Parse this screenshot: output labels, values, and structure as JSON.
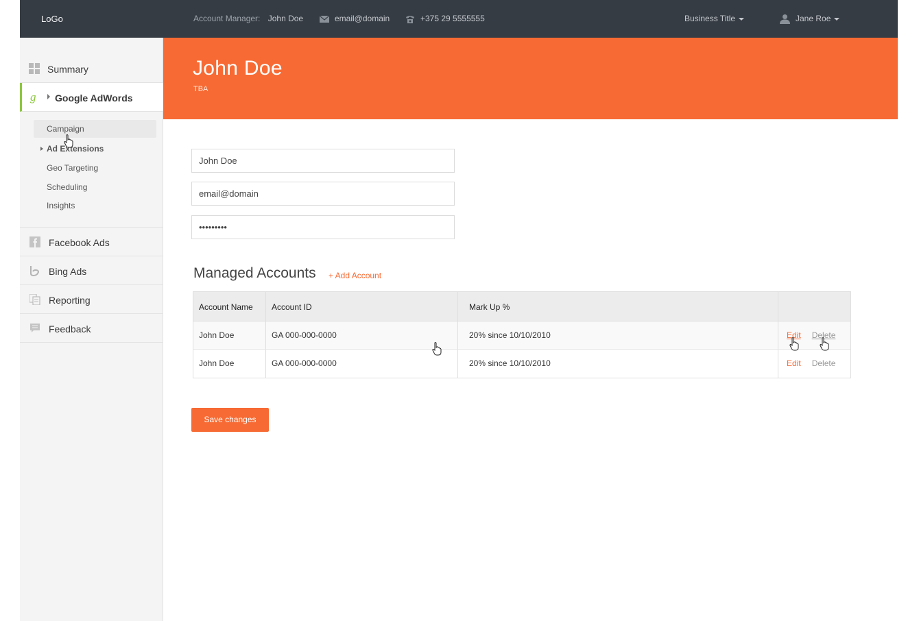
{
  "topbar": {
    "logo": "LoGo",
    "manager_label": "Account Manager:",
    "manager_name": "John Doe",
    "email": "email@domain",
    "phone": "+375 29 5555555",
    "business": "Business Title",
    "user": "Jane Roe"
  },
  "sidebar": {
    "summary": "Summary",
    "adwords": "Google AdWords",
    "sub_items": [
      "Campaign",
      "Ad Extensions",
      "Geo Targeting",
      "Scheduling",
      "Insights"
    ],
    "facebook": "Facebook Ads",
    "bing": "Bing Ads",
    "reporting": "Reporting",
    "feedback": "Feedback"
  },
  "header": {
    "name": "John Doe",
    "subtitle": "TBA"
  },
  "form": {
    "name_value": "John Doe",
    "email_value": "email@domain",
    "password_value": "•••••••••"
  },
  "accounts": {
    "title": "Managed Accounts",
    "add_label": "+ Add Account",
    "columns": [
      "Account Name",
      "Account ID",
      "Mark Up %",
      ""
    ],
    "rows": [
      {
        "name": "John Doe",
        "id": "GA 000-000-0000",
        "markup": "20% since 10/10/2010",
        "edit": "Edit",
        "delete": "Delete"
      },
      {
        "name": "John Doe",
        "id": "GA 000-000-0000",
        "markup": "20% since 10/10/2010",
        "edit": "Edit",
        "delete": "Delete"
      }
    ]
  },
  "save_label": "Save changes",
  "colors": {
    "accent": "#f76a33",
    "topbar": "#363c44",
    "active_marker": "#8cc63f"
  }
}
